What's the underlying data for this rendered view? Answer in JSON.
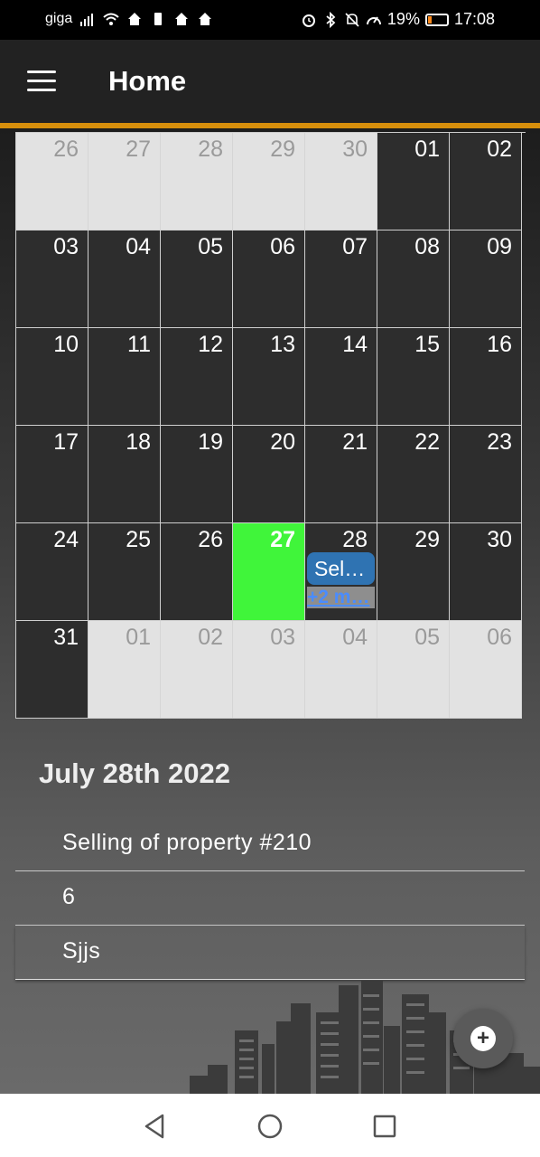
{
  "status_bar": {
    "carrier": "giga",
    "battery_percent": "19%",
    "battery_level": 0.19,
    "time": "17:08",
    "icons_left": [
      "signal-icon",
      "wifi-icon",
      "home-icon",
      "battery-saver-icon",
      "home-icon",
      "home-icon"
    ],
    "icons_right": [
      "alarm-icon",
      "bluetooth-icon",
      "mute-icon",
      "speed-icon"
    ]
  },
  "app_bar": {
    "title": "Home",
    "menu_icon": "hamburger-menu-icon",
    "accent_color": "#d78f0c"
  },
  "calendar": {
    "weeks": [
      [
        {
          "day": "26",
          "muted": true
        },
        {
          "day": "27",
          "muted": true
        },
        {
          "day": "28",
          "muted": true
        },
        {
          "day": "29",
          "muted": true
        },
        {
          "day": "30",
          "muted": true
        },
        {
          "day": "01"
        },
        {
          "day": "02"
        }
      ],
      [
        {
          "day": "03"
        },
        {
          "day": "04"
        },
        {
          "day": "05"
        },
        {
          "day": "06"
        },
        {
          "day": "07"
        },
        {
          "day": "08"
        },
        {
          "day": "09"
        }
      ],
      [
        {
          "day": "10"
        },
        {
          "day": "11"
        },
        {
          "day": "12"
        },
        {
          "day": "13"
        },
        {
          "day": "14"
        },
        {
          "day": "15"
        },
        {
          "day": "16"
        }
      ],
      [
        {
          "day": "17"
        },
        {
          "day": "18"
        },
        {
          "day": "19"
        },
        {
          "day": "20"
        },
        {
          "day": "21"
        },
        {
          "day": "22"
        },
        {
          "day": "23"
        }
      ],
      [
        {
          "day": "24"
        },
        {
          "day": "25"
        },
        {
          "day": "26"
        },
        {
          "day": "27",
          "today": true
        },
        {
          "day": "28",
          "event": "Sel…",
          "more": "+2 m…"
        },
        {
          "day": "29"
        },
        {
          "day": "30"
        }
      ],
      [
        {
          "day": "31"
        },
        {
          "day": "01",
          "muted": true
        },
        {
          "day": "02",
          "muted": true
        },
        {
          "day": "03",
          "muted": true
        },
        {
          "day": "04",
          "muted": true
        },
        {
          "day": "05",
          "muted": true
        },
        {
          "day": "06",
          "muted": true
        }
      ]
    ],
    "today_color": "#40f53a",
    "event_color": "#2f73b2"
  },
  "selected_day": {
    "heading": "July 28th 2022",
    "events": [
      "Selling of property #210",
      "6",
      "Sjjs"
    ]
  },
  "fab": {
    "icon": "plus-icon"
  },
  "nav_bar": {
    "buttons": [
      "back-icon",
      "home-circle-icon",
      "recents-square-icon"
    ]
  }
}
